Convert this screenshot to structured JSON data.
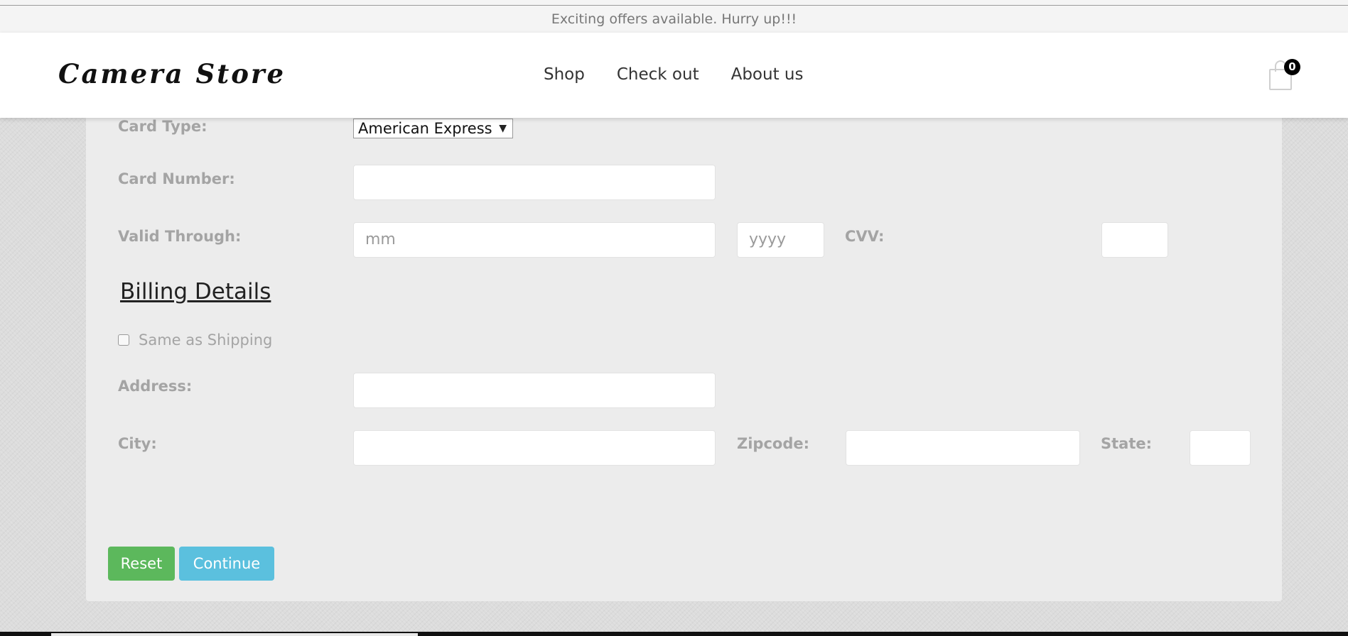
{
  "offer_bar": {
    "text": "Exciting offers available. Hurry up!!!"
  },
  "header": {
    "logo": "Camera Store",
    "nav": [
      "Shop",
      "Check out",
      "About us"
    ],
    "cart": {
      "count": "0",
      "icon": "shopping-bag-icon"
    }
  },
  "payment": {
    "card_type_label": "Card Type:",
    "card_type_value": "American Express",
    "card_number_label": "Card Number:",
    "card_number_value": "",
    "valid_through_label": "Valid Through:",
    "month_placeholder": "mm",
    "year_placeholder": "yyyy",
    "cvv_label": "CVV:",
    "cvv_value": ""
  },
  "billing": {
    "title": "Billing Details",
    "same_as_shipping_label": "Same as Shipping",
    "same_as_shipping_checked": false,
    "address_label": "Address:",
    "address_value": "",
    "city_label": "City:",
    "city_value": "",
    "zipcode_label": "Zipcode:",
    "zipcode_value": "",
    "state_label": "State:",
    "state_value": ""
  },
  "actions": {
    "reset": "Reset",
    "continue": "Continue"
  },
  "colors": {
    "reset": "#5cb85c",
    "continue": "#5bc0de",
    "panel": "#ececec"
  }
}
